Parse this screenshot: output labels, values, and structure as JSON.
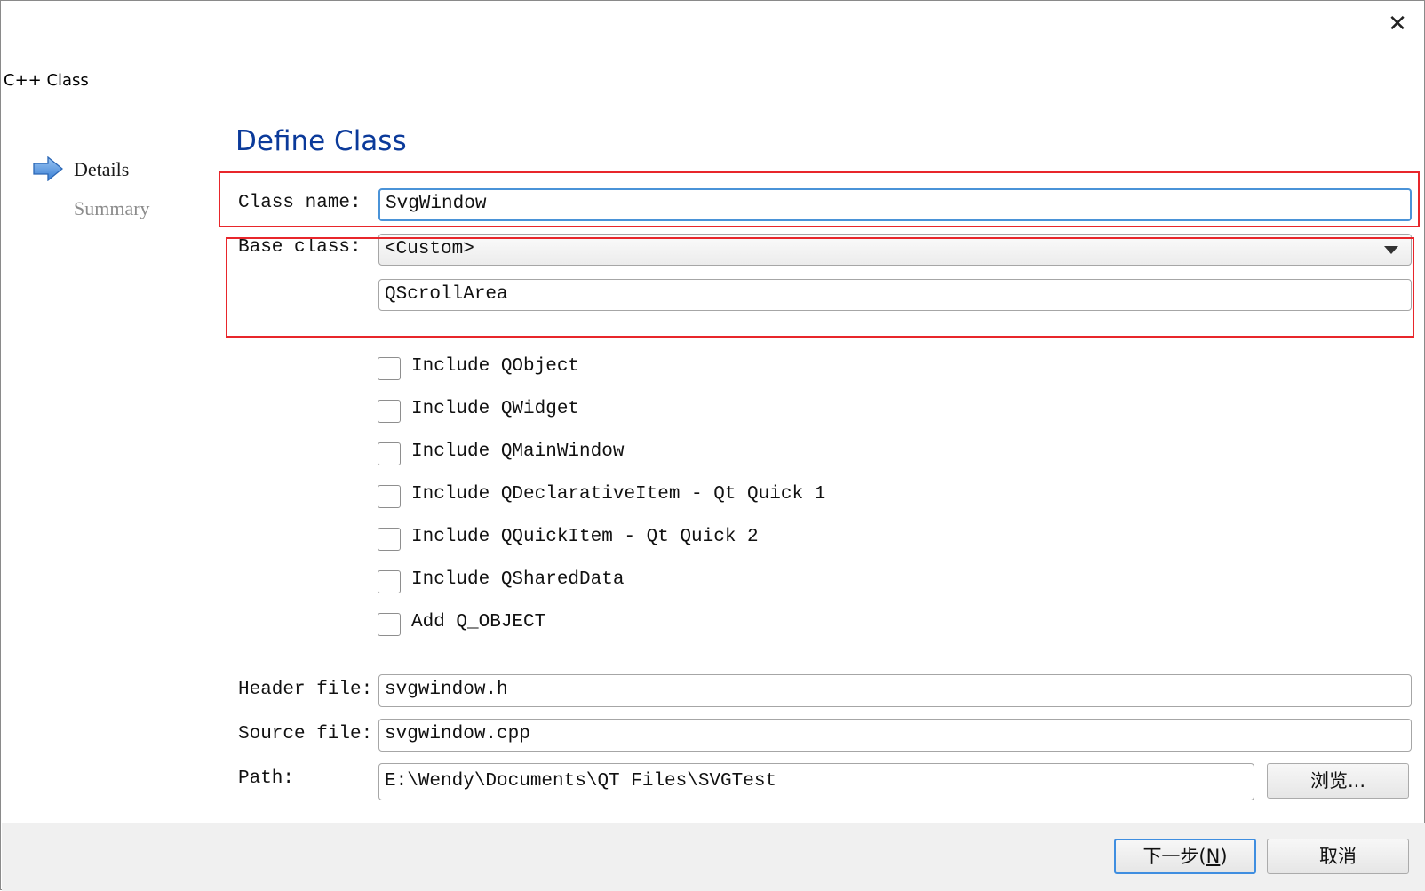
{
  "window": {
    "title": "C++ Class",
    "close_glyph": "✕"
  },
  "steps": {
    "items": [
      {
        "label": "Details",
        "active": true
      },
      {
        "label": "Summary",
        "active": false
      }
    ]
  },
  "page": {
    "title": "Define Class"
  },
  "form": {
    "class_name_label": "Class name:",
    "class_name_value": "SvgWindow",
    "base_class_label": "Base class:",
    "base_class_selected": "<Custom>",
    "custom_base_value": "QScrollArea",
    "header_file_label": "Header file:",
    "header_file_value": "svgwindow.h",
    "source_file_label": "Source file:",
    "source_file_value": "svgwindow.cpp",
    "path_label": "Path:",
    "path_value": "E:\\Wendy\\Documents\\QT Files\\SVGTest",
    "browse_label": "浏览..."
  },
  "options": [
    {
      "label": "Include QObject",
      "checked": false
    },
    {
      "label": "Include QWidget",
      "checked": false
    },
    {
      "label": "Include QMainWindow",
      "checked": false
    },
    {
      "label": "Include QDeclarativeItem - Qt Quick 1",
      "checked": false
    },
    {
      "label": "Include QQuickItem - Qt Quick 2",
      "checked": false
    },
    {
      "label": "Include QSharedData",
      "checked": false
    },
    {
      "label": "Add Q_OBJECT",
      "checked": false
    }
  ],
  "footer": {
    "next_prefix": "下一步(",
    "next_mnemonic": "N",
    "next_suffix": ")",
    "cancel_label": "取消"
  },
  "colors": {
    "accent": "#0b3a9a",
    "highlight": "#e8262b",
    "focus": "#4a93d8"
  }
}
